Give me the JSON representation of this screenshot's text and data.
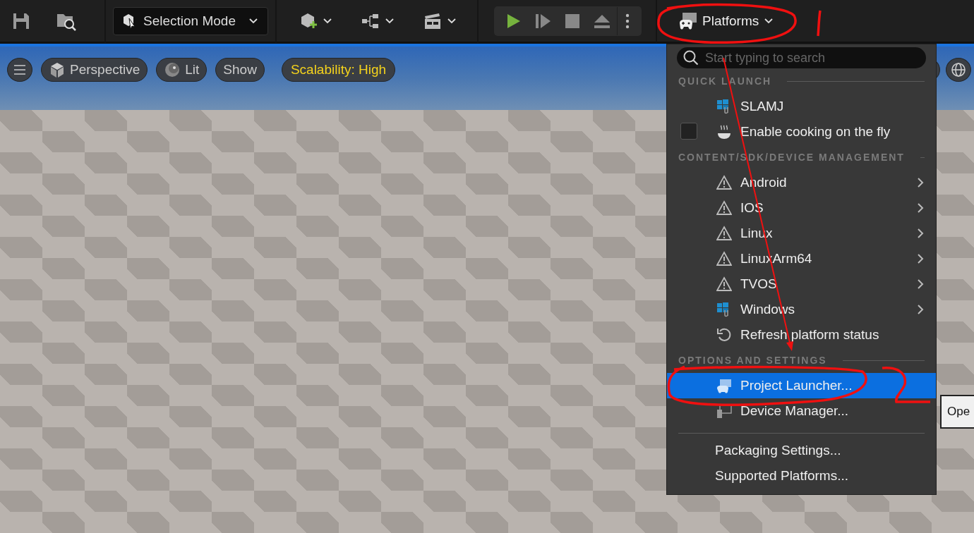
{
  "toolbar": {
    "mode": "Selection Mode",
    "platforms": "Platforms"
  },
  "viewport_toolbar": [
    {
      "kind": "menu"
    },
    {
      "kind": "perspective",
      "label": "Perspective"
    },
    {
      "kind": "lit",
      "label": "Lit"
    },
    {
      "kind": "plain",
      "label": "Show"
    },
    {
      "kind": "scalability",
      "label": "Scalability: High"
    }
  ],
  "platforms_menu": {
    "search": {
      "placeholder": "Start typing to search"
    },
    "sections": [
      {
        "heading": "QUICK LAUNCH",
        "items": [
          {
            "kind": "launch",
            "label": "SLAMJ",
            "selected": false,
            "submenu": false
          },
          {
            "kind": "checkbox",
            "label": "Enable cooking on the fly",
            "checked": false,
            "selected": false,
            "submenu": false
          }
        ]
      },
      {
        "heading": "CONTENT/SDK/DEVICE MANAGEMENT",
        "items": [
          {
            "kind": "warning",
            "label": "Android",
            "selected": false,
            "submenu": true
          },
          {
            "kind": "warning",
            "label": "IOS",
            "selected": false,
            "submenu": true
          },
          {
            "kind": "warning",
            "label": "Linux",
            "selected": false,
            "submenu": true
          },
          {
            "kind": "warning",
            "label": "LinuxArm64",
            "selected": false,
            "submenu": true
          },
          {
            "kind": "warning",
            "label": "TVOS",
            "selected": false,
            "submenu": true
          },
          {
            "kind": "launch",
            "label": "Windows",
            "selected": false,
            "submenu": true
          },
          {
            "kind": "refresh",
            "label": "Refresh platform status",
            "selected": false,
            "submenu": false
          }
        ]
      },
      {
        "heading": "OPTIONS AND SETTINGS",
        "items": [
          {
            "kind": "launcher",
            "label": "Project Launcher...",
            "selected": true,
            "submenu": false
          },
          {
            "kind": "device",
            "label": "Device Manager...",
            "selected": false,
            "submenu": false
          }
        ]
      },
      {
        "items": [
          {
            "kind": "plain",
            "label": "Packaging Settings...",
            "selected": false,
            "submenu": false
          },
          {
            "kind": "plain",
            "label": "Supported Platforms...",
            "selected": false,
            "submenu": false
          }
        ]
      }
    ]
  },
  "tooltip": {
    "text": "Ope"
  }
}
